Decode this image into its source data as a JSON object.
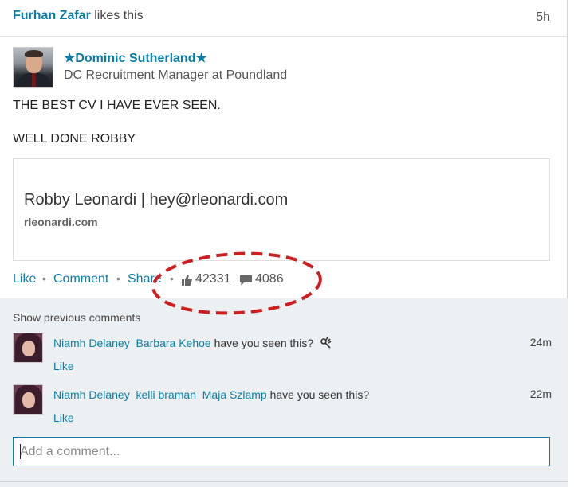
{
  "activity": {
    "actor": "Furhan Zafar",
    "action": "likes this",
    "time": "5h"
  },
  "post": {
    "author_name": "★Dominic Sutherland★",
    "author_title": "DC Recruitment Manager at Poundland",
    "text_line_1": "THE BEST CV I HAVE EVER SEEN.",
    "text_line_2": "WELL DONE ROBBY",
    "link_title": "Robby Leonardi | hey@rleonardi.com",
    "link_domain": "rleonardi.com"
  },
  "actions": {
    "like": "Like",
    "comment": "Comment",
    "share": "Share",
    "separator": "•",
    "likes_count": "42331",
    "comments_count": "4086"
  },
  "comments": {
    "show_previous": "Show previous comments",
    "items": [
      {
        "author": "Niamh Delaney",
        "mentions": [
          "Barbara Kehoe"
        ],
        "text": "have you seen this?",
        "emoji": "ok-hand-icon",
        "time": "24m",
        "like": "Like"
      },
      {
        "author": "Niamh Delaney",
        "mentions": [
          "kelli braman",
          "Maja Szlamp"
        ],
        "text": "have you seen this?",
        "time": "22m",
        "like": "Like"
      }
    ],
    "add_placeholder": "Add a comment..."
  },
  "colors": {
    "link_blue": "#0a7ea8",
    "annotation_red": "#cc1f1f",
    "comments_bg": "#edf0f3"
  }
}
